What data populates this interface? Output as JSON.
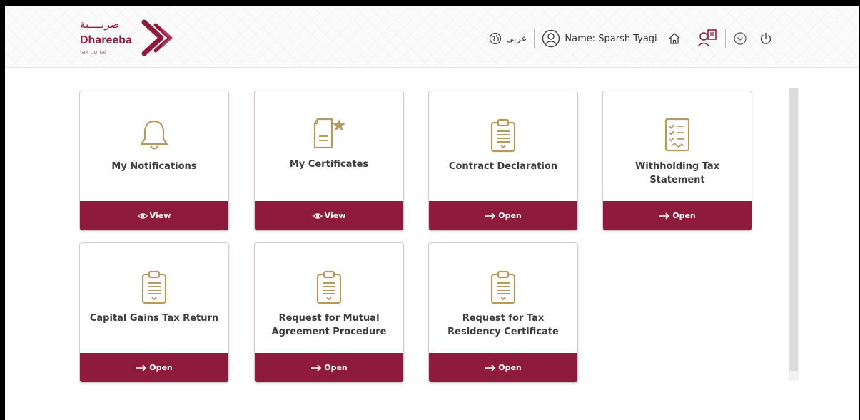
{
  "brand": {
    "arabic": "ضريــــبة",
    "name": "Dhareeba",
    "sub": "tax portal",
    "color": "#8e1b3e"
  },
  "header": {
    "language_label": "عربي",
    "user_label": "Name: Sparsh Tyagi",
    "icons": [
      "globe-icon",
      "user-circle-icon",
      "home-icon",
      "switch-account-icon",
      "chevron-down-icon",
      "power-icon"
    ]
  },
  "cards": [
    {
      "title": "My Notifications",
      "icon": "bell-icon",
      "action": "View",
      "action_icon": "eye-icon"
    },
    {
      "title": "My Certificates",
      "icon": "certificate-icon",
      "action": "View",
      "action_icon": "eye-icon"
    },
    {
      "title": "Contract Declaration",
      "icon": "clipboard-icon",
      "action": "Open",
      "action_icon": "arrow-right-icon"
    },
    {
      "title": "Withholding Tax Statement",
      "icon": "checklist-icon",
      "action": "Open",
      "action_icon": "arrow-right-icon"
    },
    {
      "title": "Capital Gains Tax Return",
      "icon": "clipboard-icon",
      "action": "Open",
      "action_icon": "arrow-right-icon"
    },
    {
      "title": "Request for Mutual Agreement Procedure",
      "icon": "clipboard-icon",
      "action": "Open",
      "action_icon": "arrow-right-icon"
    },
    {
      "title": "Request for Tax Residency Certificate",
      "icon": "clipboard-icon",
      "action": "Open",
      "action_icon": "arrow-right-icon"
    }
  ]
}
